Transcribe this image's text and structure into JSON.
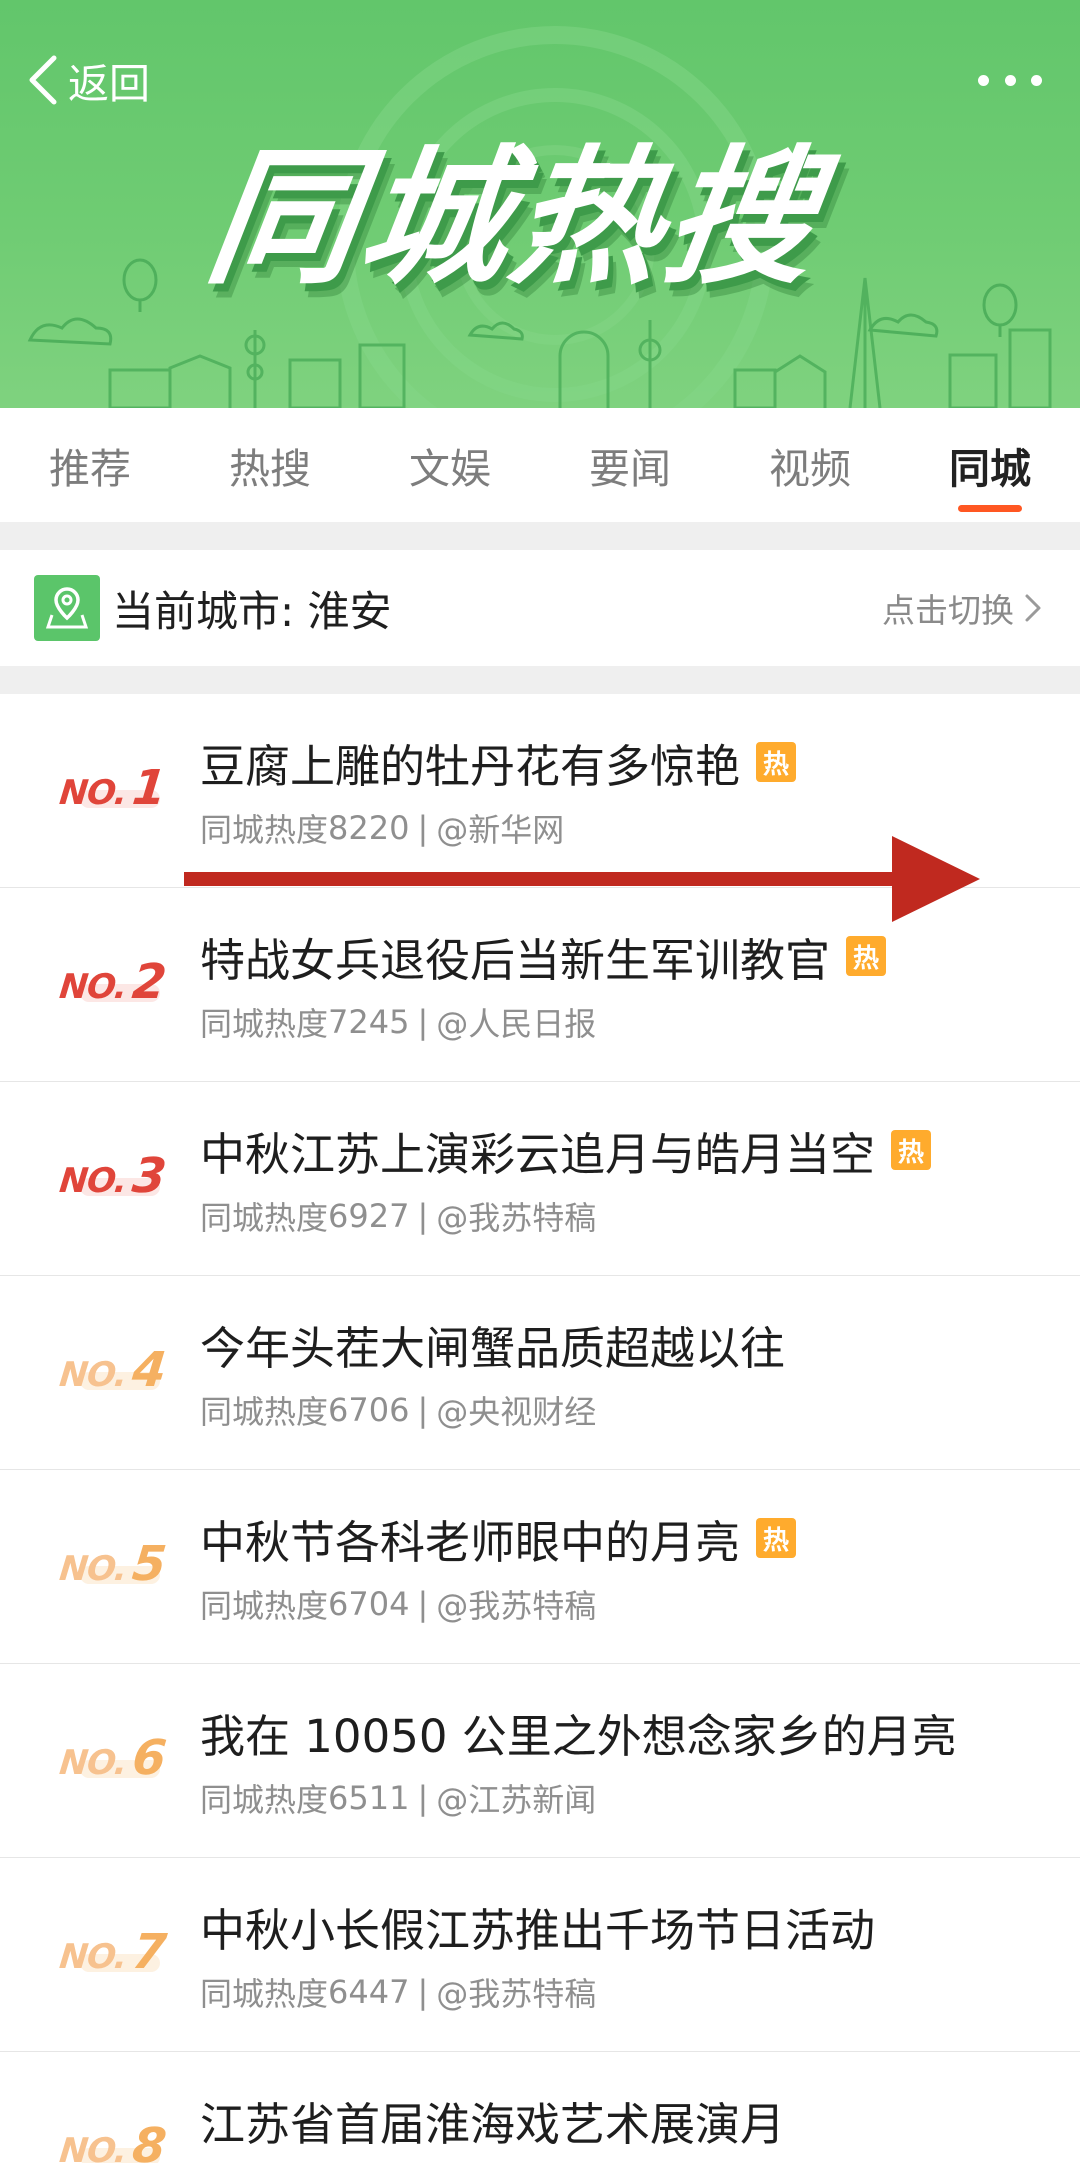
{
  "header": {
    "back_label": "返回",
    "banner_title": "同城热搜"
  },
  "tabs": [
    {
      "label": "推荐",
      "active": false
    },
    {
      "label": "热搜",
      "active": false
    },
    {
      "label": "文娱",
      "active": false
    },
    {
      "label": "要闻",
      "active": false
    },
    {
      "label": "视频",
      "active": false
    },
    {
      "label": "同城",
      "active": true
    }
  ],
  "city_bar": {
    "label": "当前城市: 淮安",
    "switch_label": "点击切换"
  },
  "colors": {
    "banner_green": "#6fcc73",
    "tab_indicator": "#ff5722",
    "rank_top": "#e0453a",
    "rank_low": "#f5b061",
    "hot_badge": "#ffab2d",
    "arrow_red": "#c0291f"
  },
  "list": [
    {
      "rank_no": "NO.",
      "rank_num": "1",
      "title": "豆腐上雕的牡丹花有多惊艳",
      "hot": true,
      "hot_label": "热",
      "meta_prefix": "同城热度",
      "heat": "8220",
      "source": "@新华网"
    },
    {
      "rank_no": "NO.",
      "rank_num": "2",
      "title": "特战女兵退役后当新生军训教官",
      "hot": true,
      "hot_label": "热",
      "meta_prefix": "同城热度",
      "heat": "7245",
      "source": "@人民日报"
    },
    {
      "rank_no": "NO.",
      "rank_num": "3",
      "title": "中秋江苏上演彩云追月与皓月当空",
      "hot": true,
      "hot_label": "热",
      "meta_prefix": "同城热度",
      "heat": "6927",
      "source": "@我苏特稿"
    },
    {
      "rank_no": "NO.",
      "rank_num": "4",
      "title": "今年头茬大闸蟹品质超越以往",
      "hot": false,
      "hot_label": "",
      "meta_prefix": "同城热度",
      "heat": "6706",
      "source": "@央视财经"
    },
    {
      "rank_no": "NO.",
      "rank_num": "5",
      "title": "中秋节各科老师眼中的月亮",
      "hot": true,
      "hot_label": "热",
      "meta_prefix": "同城热度",
      "heat": "6704",
      "source": "@我苏特稿"
    },
    {
      "rank_no": "NO.",
      "rank_num": "6",
      "title": "我在 10050 公里之外想念家乡的月亮",
      "hot": false,
      "hot_label": "",
      "meta_prefix": "同城热度",
      "heat": "6511",
      "source": "@江苏新闻"
    },
    {
      "rank_no": "NO.",
      "rank_num": "7",
      "title": "中秋小长假江苏推出千场节日活动",
      "hot": false,
      "hot_label": "",
      "meta_prefix": "同城热度",
      "heat": "6447",
      "source": "@我苏特稿"
    },
    {
      "rank_no": "NO.",
      "rank_num": "8",
      "title": "江苏省首届淮海戏艺术展演月",
      "hot": false,
      "hot_label": "",
      "meta_prefix": "",
      "heat": "",
      "source": ""
    }
  ]
}
